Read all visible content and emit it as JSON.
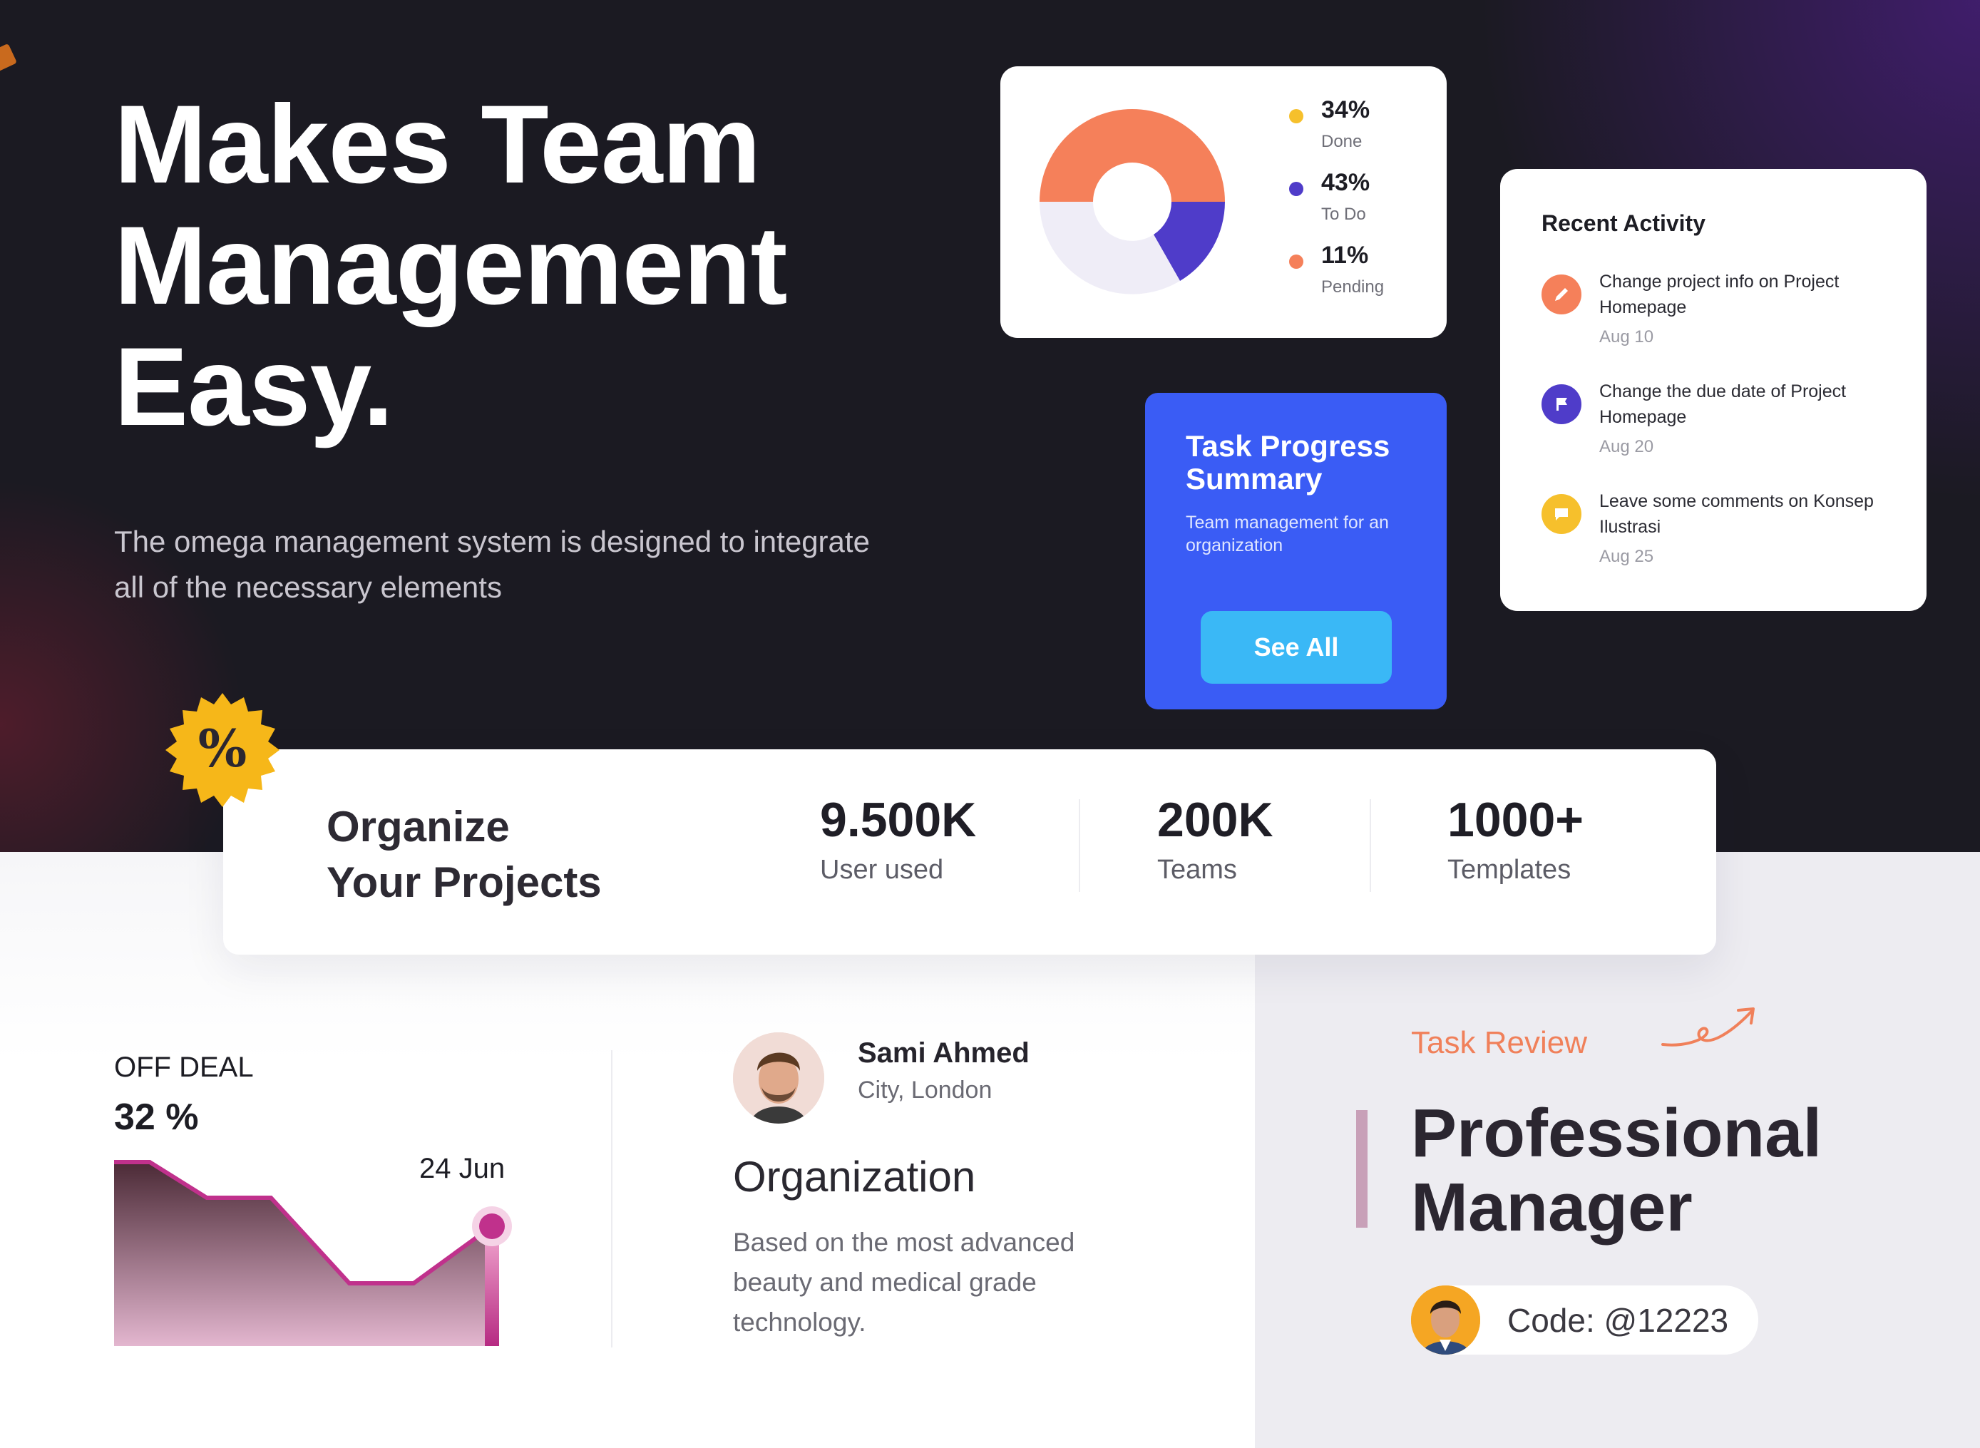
{
  "hero": {
    "title_lines": [
      "Makes Team",
      "Management",
      "Easy."
    ],
    "description": "The omega management system is designed to integrate all of the necessary elements"
  },
  "donut": {
    "items": [
      {
        "value": "34%",
        "label": "Done",
        "color": "#f6c02c"
      },
      {
        "value": "43%",
        "label": "To Do",
        "color": "#4f3cc9"
      },
      {
        "value": "11%",
        "label": "Pending",
        "color": "#f5805a"
      }
    ]
  },
  "task_card": {
    "title": "Task Progress Summary",
    "subtitle": "Team management for an organization",
    "button_label": "See All",
    "color": "#3a5cf5"
  },
  "activity": {
    "title": "Recent Activity",
    "items": [
      {
        "text": "Change project info on Project Homepage",
        "date": "Aug 10",
        "icon": "pencil-icon",
        "color": "#f5805a"
      },
      {
        "text": "Change the due date of Project Homepage",
        "date": "Aug 20",
        "icon": "flag-icon",
        "color": "#4f3cc9"
      },
      {
        "text": "Leave some comments on Konsep Ilustrasi",
        "date": "Aug 25",
        "icon": "comment-icon",
        "color": "#f6c02c"
      }
    ]
  },
  "stats": {
    "heading_lines": [
      "Organize",
      "Your Projects"
    ],
    "badge_symbol": "%",
    "items": [
      {
        "value": "9.500K",
        "label": "User used"
      },
      {
        "value": "200K",
        "label": "Teams"
      },
      {
        "value": "1000+",
        "label": "Templates"
      }
    ]
  },
  "deal": {
    "label": "OFF DEAL",
    "value": "32 %",
    "date": "24 Jun"
  },
  "profile": {
    "name": "Sami Ahmed",
    "city": "City, London",
    "org_title": "Organization",
    "org_desc": "Based on the most advanced beauty and medical grade technology."
  },
  "task_review": {
    "label": "Task Review",
    "title_lines": [
      "Professional",
      "Manager"
    ],
    "code": "Code: @12223",
    "accent": "#f0805a"
  }
}
